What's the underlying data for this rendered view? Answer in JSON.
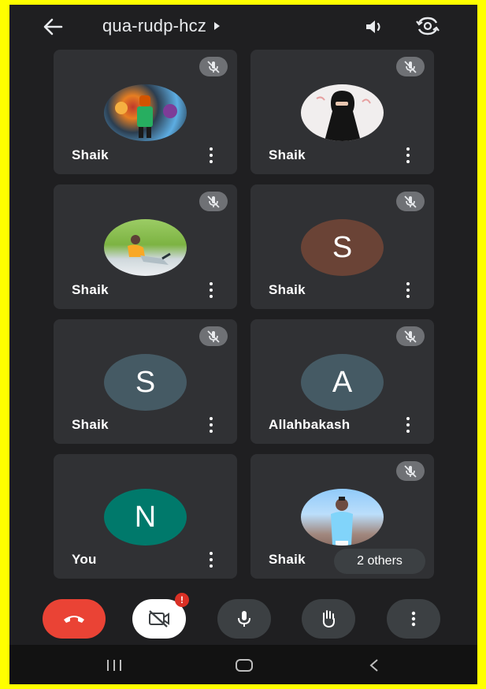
{
  "meeting": {
    "code": "qua-rudp-hcz"
  },
  "participants": [
    {
      "name": "Shaik",
      "avatar_type": "photo",
      "muted": true
    },
    {
      "name": "Shaik",
      "avatar_type": "photo",
      "muted": true
    },
    {
      "name": "Shaik",
      "avatar_type": "photo",
      "muted": true
    },
    {
      "name": "Shaik",
      "avatar_type": "initial",
      "initial": "S",
      "avatar_color": "#6a4336",
      "muted": true
    },
    {
      "name": "Shaik",
      "avatar_type": "initial",
      "initial": "S",
      "avatar_color": "#455a64",
      "muted": true
    },
    {
      "name": "Allahbakash",
      "avatar_type": "initial",
      "initial": "A",
      "avatar_color": "#455a64",
      "muted": true
    },
    {
      "name": "You",
      "avatar_type": "initial",
      "initial": "N",
      "avatar_color": "#00796b",
      "muted": false
    },
    {
      "name": "Shaik",
      "avatar_type": "photo",
      "muted": true
    }
  ],
  "others_chip": "2 others",
  "controls": {
    "camera_badge": "!"
  },
  "colors": {
    "background": "#1f1f21",
    "tile": "#303134",
    "end_call": "#ea4335",
    "frame_border": "#ffff00"
  },
  "icons": {
    "back": "arrow-left-icon",
    "speaker": "speaker-icon",
    "switch_camera": "switch-camera-icon",
    "mic_off": "mic-off-icon",
    "end_call": "phone-hangup-icon",
    "camera_off": "camera-off-icon",
    "mic": "mic-icon",
    "raise_hand": "hand-icon",
    "more": "more-vert-icon"
  }
}
